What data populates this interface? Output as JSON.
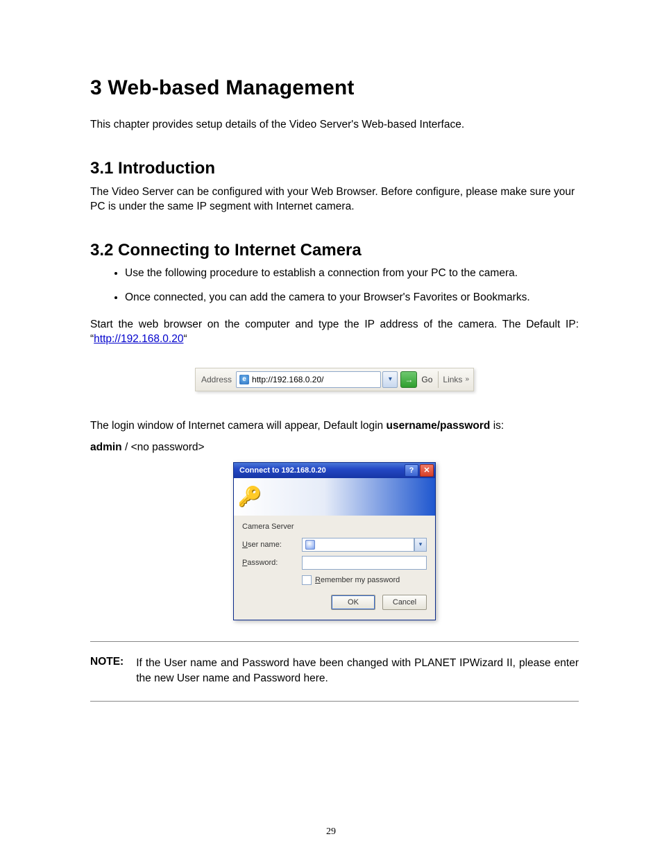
{
  "h1": "3  Web-based Management",
  "intro_p": "This chapter provides setup details of the Video Server's Web-based Interface.",
  "h2_1": "3.1 Introduction",
  "p_31": "The Video Server can be configured with your Web Browser. Before configure, please make sure your PC is under the same IP segment with Internet camera.",
  "h2_2": "3.2 Connecting to Internet Camera",
  "bullets": [
    "Use the following procedure to establish a connection from your PC to the camera.",
    "Once connected, you can add the camera to your Browser's Favorites or Bookmarks."
  ],
  "p_start_pre": "Start the web browser on the computer and type the IP address of the camera. The Default IP: “",
  "default_ip_link": "http://192.168.0.20",
  "p_start_post": "“",
  "addressbar": {
    "label": "Address",
    "url": "http://192.168.0.20/",
    "go": "Go",
    "links": "Links"
  },
  "p_login_pre": "The login window of Internet camera will appear, Default login ",
  "p_login_bold": "username/password",
  "p_login_post": " is:",
  "cred_admin": "admin",
  "cred_sep": " / <no password>",
  "dialog": {
    "title": "Connect to 192.168.0.20",
    "server": "Camera Server",
    "user_label": "User name:",
    "pass_label": "Password:",
    "remember": "Remember my password",
    "ok": "OK",
    "cancel": "Cancel",
    "user_u": "U",
    "user_rest": "ser name:",
    "pass_p": "P",
    "pass_rest": "assword:",
    "rem_r": "R",
    "rem_rest": "emember my password"
  },
  "note_label": "NOTE:",
  "note_text": "If the User name and Password have been changed with PLANET IPWizard II, please enter the new User name and Password here.",
  "page_number": "29"
}
